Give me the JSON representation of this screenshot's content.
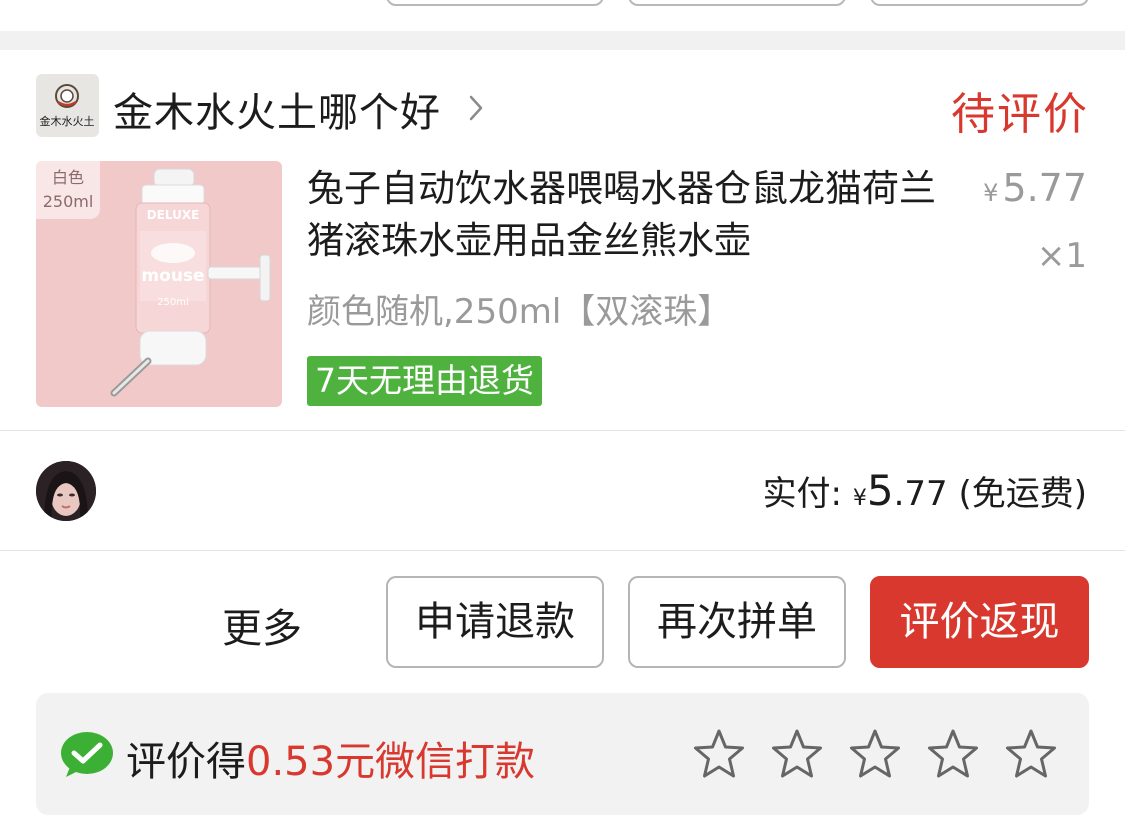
{
  "shop": {
    "logo_text": "金木水火土",
    "name": "金木水火土哪个好",
    "status": "待评价"
  },
  "product": {
    "image_tag_color": "白色",
    "image_tag_size": "250ml",
    "image_brand": "DELUXE",
    "image_label": "mouse",
    "image_volume": "250ml",
    "title": "兔子自动饮水器喂喝水器仓鼠龙猫荷兰猪滚珠水壶用品金丝熊水壶",
    "price_currency": "¥",
    "price": "5.77",
    "quantity": "×1",
    "spec": "颜色随机,250ml【双滚珠】",
    "return_policy": "7天无理由退货"
  },
  "payment": {
    "label": "实付:",
    "currency": "¥",
    "amount_int": "5",
    "amount_dec": ".77",
    "shipping_note": "(免运费)"
  },
  "actions": {
    "more": "更多",
    "refund": "申请退款",
    "reorder": "再次拼单",
    "review": "评价返现"
  },
  "reward": {
    "prefix": "评价得",
    "amount_text": "0.53元微信打款",
    "rating": 0,
    "max_rating": 5
  },
  "colors": {
    "accent_red": "#d8382d",
    "badge_green": "#4fb23e",
    "wechat_green": "#3cb034"
  }
}
